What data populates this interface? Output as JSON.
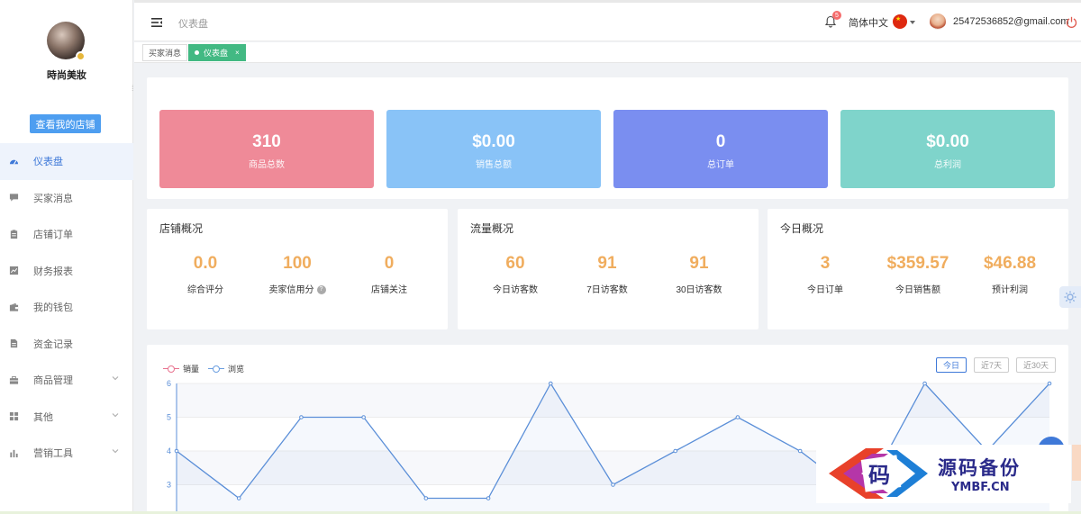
{
  "sidebar": {
    "shop_name": "時尚美妝",
    "view_shop_button": "查看我的店铺",
    "items": [
      {
        "label": "仪表盘",
        "icon": "dashboard-icon",
        "active": true
      },
      {
        "label": "买家消息",
        "icon": "message-icon"
      },
      {
        "label": "店铺订单",
        "icon": "clipboard-icon"
      },
      {
        "label": "财务报表",
        "icon": "chart-icon"
      },
      {
        "label": "我的钱包",
        "icon": "wallet-icon"
      },
      {
        "label": "资金记录",
        "icon": "document-icon"
      },
      {
        "label": "商品管理",
        "icon": "briefcase-icon",
        "expandable": true
      },
      {
        "label": "其他",
        "icon": "grid-icon",
        "expandable": true
      },
      {
        "label": "营销工具",
        "icon": "bar-chart-icon",
        "expandable": true
      }
    ]
  },
  "header": {
    "title": "仪表盘",
    "notification_count": "5",
    "language": "简体中文",
    "user_email": "25472536852@gmail.com"
  },
  "tabs": [
    {
      "label": "买家消息",
      "active": false
    },
    {
      "label": "仪表盘",
      "active": true,
      "close": "×"
    }
  ],
  "stats": [
    {
      "value": "310",
      "label": "商品总数",
      "color": "#ef8a98"
    },
    {
      "value": "$0.00",
      "label": "销售总额",
      "color": "#89c3f7"
    },
    {
      "value": "0",
      "label": "总订单",
      "color": "#7a8ef0"
    },
    {
      "value": "$0.00",
      "label": "总利润",
      "color": "#7fd4cb"
    }
  ],
  "overview": [
    {
      "title": "店铺概况",
      "metrics": [
        {
          "value": "0.0",
          "label": "综合评分"
        },
        {
          "value": "100",
          "label": "卖家信用分",
          "help": "?"
        },
        {
          "value": "0",
          "label": "店铺关注"
        }
      ]
    },
    {
      "title": "流量概况",
      "metrics": [
        {
          "value": "60",
          "label": "今日访客数"
        },
        {
          "value": "91",
          "label": "7日访客数"
        },
        {
          "value": "91",
          "label": "30日访客数"
        }
      ]
    },
    {
      "title": "今日概况",
      "metrics": [
        {
          "value": "3",
          "label": "今日订单"
        },
        {
          "value": "$359.57",
          "label": "今日销售额"
        },
        {
          "value": "$46.88",
          "label": "预计利润"
        }
      ]
    }
  ],
  "chart": {
    "legend": [
      "销量",
      "浏览"
    ],
    "ranges": [
      {
        "label": "今日",
        "active": true
      },
      {
        "label": "近7天",
        "active": false
      },
      {
        "label": "近30天",
        "active": false
      }
    ]
  },
  "chart_data": {
    "type": "line",
    "ylim": [
      3,
      6
    ],
    "yticks": [
      "6",
      "5",
      "4",
      "3"
    ],
    "series": [
      {
        "name": "浏览",
        "color": "#5b8fd8",
        "values": [
          4,
          2.6,
          5,
          5,
          2.6,
          2.6,
          6,
          3,
          4,
          5,
          4,
          2.6,
          6,
          4,
          6
        ]
      },
      {
        "name": "销量",
        "color": "#e8738f",
        "values": []
      }
    ]
  },
  "watermark": {
    "cn": "源码备份",
    "en": "YMBF.CN",
    "logo_char": "码"
  },
  "colors": {
    "accent": "#3f79d8",
    "metric": "#f0ad5e",
    "tab_active": "#42b983"
  }
}
